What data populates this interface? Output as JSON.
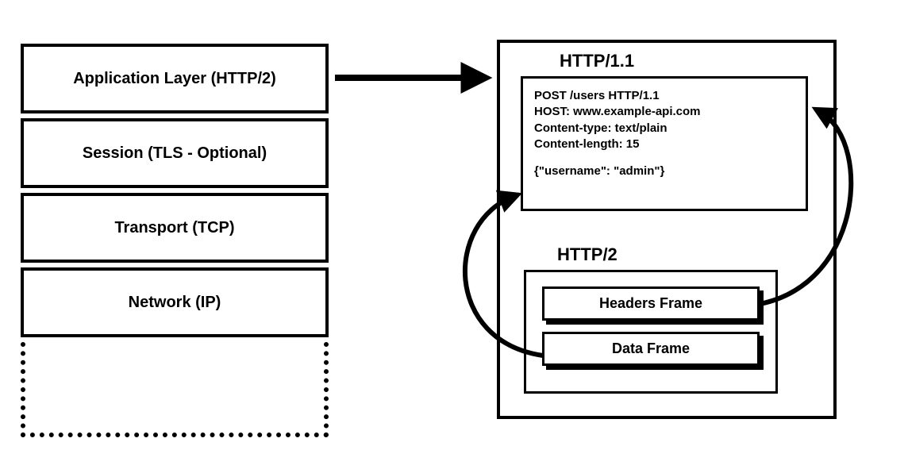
{
  "stack": {
    "layers": [
      "Application Layer (HTTP/2)",
      "Session (TLS - Optional)",
      "Transport (TCP)",
      "Network (IP)"
    ]
  },
  "right": {
    "http11_label": "HTTP/1.1",
    "http11_request": {
      "line1": "POST /users HTTP/1.1",
      "line2": "HOST: www.example-api.com",
      "line3": "Content-type: text/plain",
      "line4": "Content-length: 15",
      "body": "{\"username\": \"admin\"}"
    },
    "http2_label": "HTTP/2",
    "http2_frames": {
      "headers": "Headers Frame",
      "data": "Data Frame"
    }
  }
}
